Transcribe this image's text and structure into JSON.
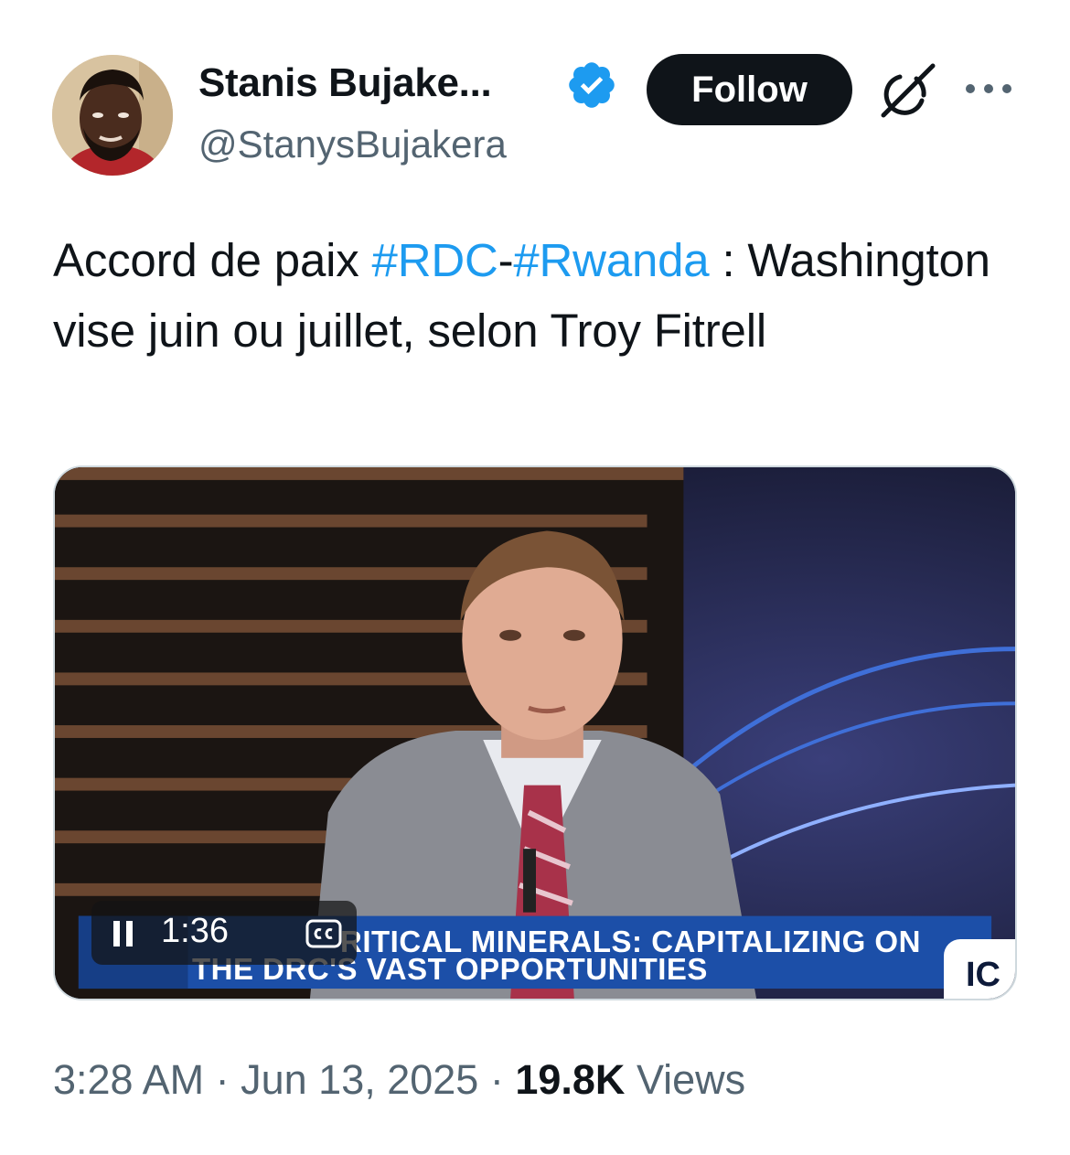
{
  "author": {
    "display_name": "Stanis Bujake...",
    "handle": "@StanysBujakera",
    "verified": true,
    "follow_label": "Follow"
  },
  "tweet": {
    "text_before": "Accord de paix ",
    "hashtag_1": "#RDC",
    "separator": "-",
    "hashtag_2": "#Rwanda",
    "text_after": " : Washington vise juin ou juillet, selon Troy Fitrell"
  },
  "video": {
    "elapsed_time": "1:36",
    "cc_label": "CC",
    "ticker_line_1": "RITICAL MINERALS: CAPITALIZING ON",
    "ticker_line_2": "THE DRC'S VAST OPPORTUNITIES",
    "corner_label": "IC"
  },
  "meta": {
    "time": "3:28 AM",
    "dot": " · ",
    "date": "Jun 13, 2025",
    "views_count": "19.8K",
    "views_label": " Views"
  },
  "colors": {
    "hashtag": "#1d9bf0",
    "verified": "#1d9bf0",
    "follow_bg": "#0f1419",
    "secondary_text": "#536471",
    "ticker_bg": "#1c4fa8"
  },
  "icons": {
    "verified": "verified-badge-icon",
    "grok": "grok-icon",
    "more": "more-options-icon",
    "pause": "pause-icon",
    "captions": "closed-captions-icon"
  }
}
